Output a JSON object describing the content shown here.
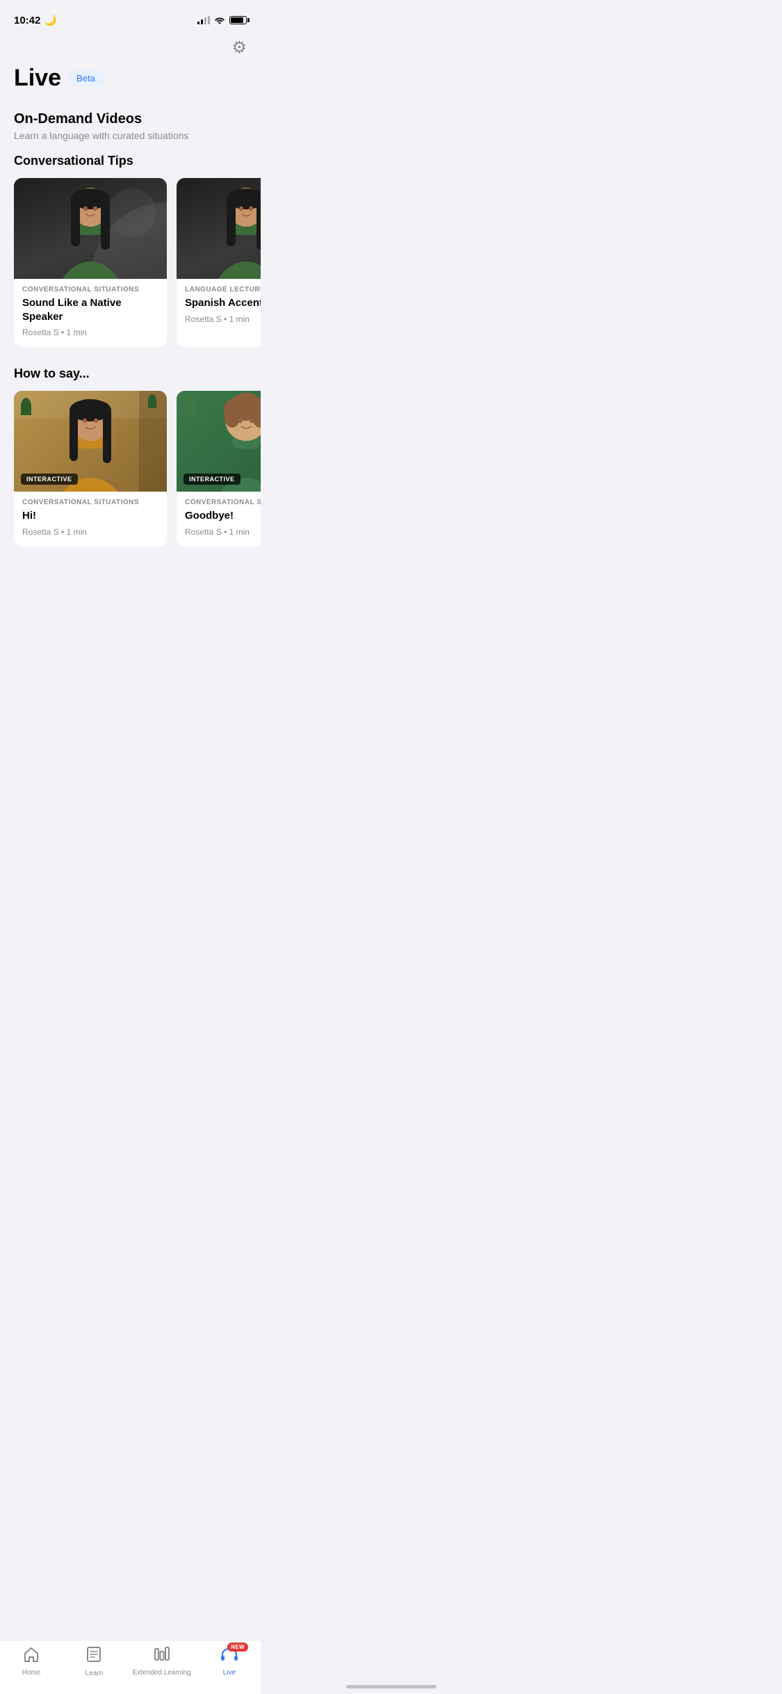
{
  "status": {
    "time": "10:42",
    "moon": "🌙"
  },
  "header": {
    "title": "Live",
    "beta_label": "Beta",
    "settings_label": "Settings"
  },
  "on_demand": {
    "section_title": "On-Demand Videos",
    "section_subtitle": "Learn a language with curated situations"
  },
  "conversational_tips": {
    "subsection_title": "Conversational Tips",
    "cards": [
      {
        "category": "CONVERSATIONAL SITUATIONS",
        "title": "Sound Like a Native Speaker",
        "meta": "Rosetta S • 1 min",
        "interactive": false
      },
      {
        "category": "LANGUAGE LECTURES",
        "title": "Spanish Accents &",
        "meta": "Rosetta S • 1 min",
        "interactive": false
      }
    ]
  },
  "how_to_say": {
    "subsection_title": "How to say...",
    "cards": [
      {
        "category": "CONVERSATIONAL SITUATIONS",
        "title": "Hi!",
        "meta": "Rosetta S • 1 min",
        "interactive": true,
        "interactive_label": "INTERACTIVE"
      },
      {
        "category": "CONVERSATIONAL S",
        "title": "Goodbye!",
        "meta": "Rosetta S • 1 min",
        "interactive": true,
        "interactive_label": "INTERACTIVE"
      }
    ]
  },
  "bottom_nav": {
    "items": [
      {
        "id": "home",
        "label": "Home",
        "active": false
      },
      {
        "id": "learn",
        "label": "Learn",
        "active": false
      },
      {
        "id": "extended-learning",
        "label": "Extended Learning",
        "active": false
      },
      {
        "id": "live",
        "label": "Live",
        "active": true,
        "badge": "NEW"
      }
    ]
  }
}
